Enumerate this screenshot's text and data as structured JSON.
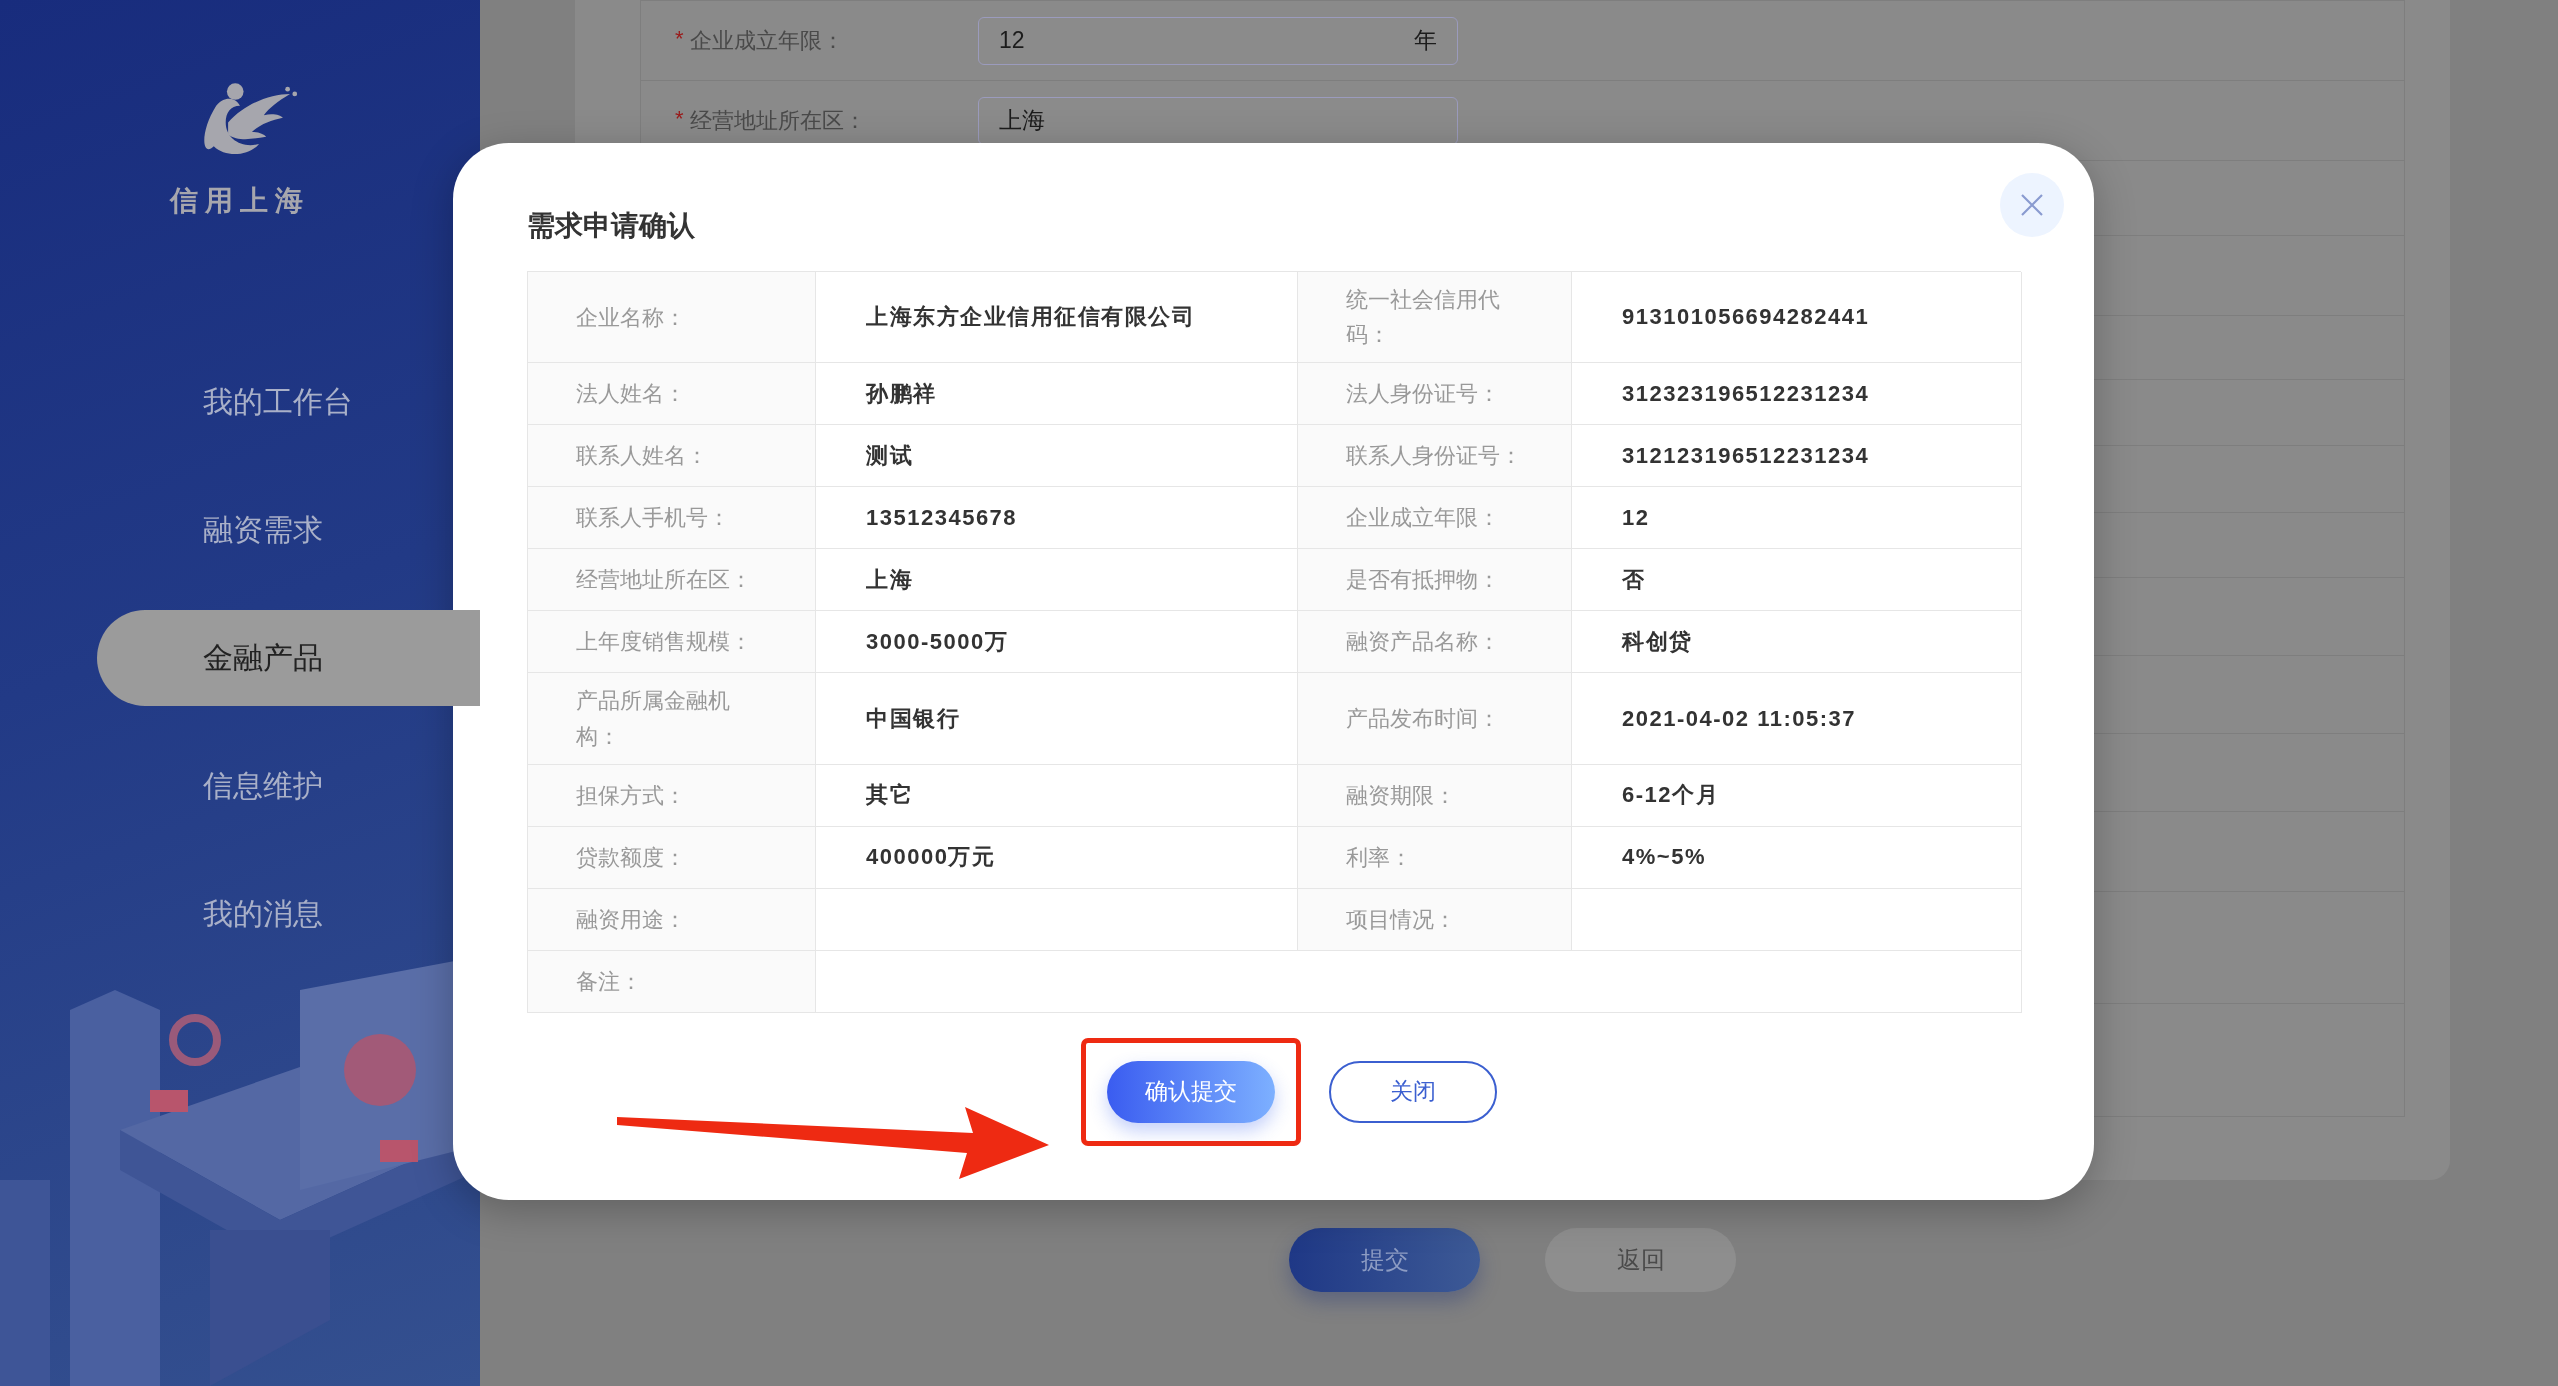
{
  "sidebar": {
    "logo_text": "信用上海",
    "items": [
      {
        "label": "我的工作台",
        "selected": false
      },
      {
        "label": "融资需求",
        "selected": false
      },
      {
        "label": "金融产品",
        "selected": true
      },
      {
        "label": "信息维护",
        "selected": false
      },
      {
        "label": "我的消息",
        "selected": false
      }
    ]
  },
  "form": {
    "fields": [
      {
        "required_mark": "*",
        "label": "企业成立年限：",
        "value": "12",
        "suffix": "年"
      },
      {
        "required_mark": "*",
        "label": "经营地址所在区：",
        "value": "上海"
      }
    ],
    "buttons": [
      {
        "label": "提交",
        "kind": "primary"
      },
      {
        "label": "返回",
        "kind": "secondary"
      }
    ]
  },
  "dialog": {
    "title": "需求申请确认",
    "rows": [
      [
        {
          "label": "企业名称：",
          "value": "上海东方企业信用征信有限公司"
        },
        {
          "label": "统一社会信用代码：",
          "value": "913101056694282441"
        }
      ],
      [
        {
          "label": "法人姓名：",
          "value": "孙鹏祥"
        },
        {
          "label": "法人身份证号：",
          "value": "312323196512231234"
        }
      ],
      [
        {
          "label": "联系人姓名：",
          "value": "测试"
        },
        {
          "label": "联系人身份证号：",
          "value": "312123196512231234"
        }
      ],
      [
        {
          "label": "联系人手机号：",
          "value": "13512345678"
        },
        {
          "label": "企业成立年限：",
          "value": "12"
        }
      ],
      [
        {
          "label": "经营地址所在区：",
          "value": "上海"
        },
        {
          "label": "是否有抵押物：",
          "value": "否"
        }
      ],
      [
        {
          "label": "上年度销售规模：",
          "value": "3000-5000万"
        },
        {
          "label": "融资产品名称：",
          "value": "科创贷"
        }
      ],
      [
        {
          "label": "产品所属金融机构：",
          "value": "中国银行"
        },
        {
          "label": "产品发布时间：",
          "value": "2021-04-02 11:05:37"
        }
      ],
      [
        {
          "label": "担保方式：",
          "value": "其它"
        },
        {
          "label": "融资期限：",
          "value": "6-12个月"
        }
      ],
      [
        {
          "label": "贷款额度：",
          "value": "400000万元"
        },
        {
          "label": "利率：",
          "value": "4%~5%"
        }
      ],
      [
        {
          "label": "融资用途："
        },
        {
          "label": "项目情况："
        }
      ],
      [
        {
          "label": "备注："
        }
      ]
    ],
    "buttons": [
      {
        "label": "确认提交",
        "kind": "primary",
        "highlighted": true
      },
      {
        "label": "关闭",
        "kind": "secondary",
        "highlighted": false
      }
    ]
  }
}
